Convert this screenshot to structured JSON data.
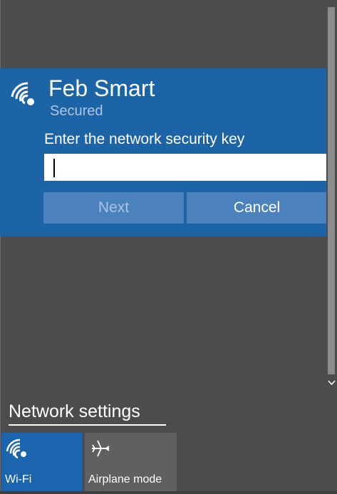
{
  "network": {
    "name": "Feb Smart",
    "status": "Secured",
    "key_label": "Enter the network security key",
    "key_value": "",
    "icon": "wifi-icon"
  },
  "buttons": {
    "next_label": "Next",
    "cancel_label": "Cancel"
  },
  "settings": {
    "link_label": "Network settings"
  },
  "quick_actions": {
    "wifi": {
      "label": "Wi-Fi",
      "icon": "wifi-icon"
    },
    "airplane": {
      "label": "Airplane mode",
      "icon": "airplane-icon"
    }
  },
  "colors": {
    "accent": "#1c64a6",
    "background": "#4b4c4d",
    "button": "#4b82bd",
    "tile_inactive": "#5f6061"
  }
}
